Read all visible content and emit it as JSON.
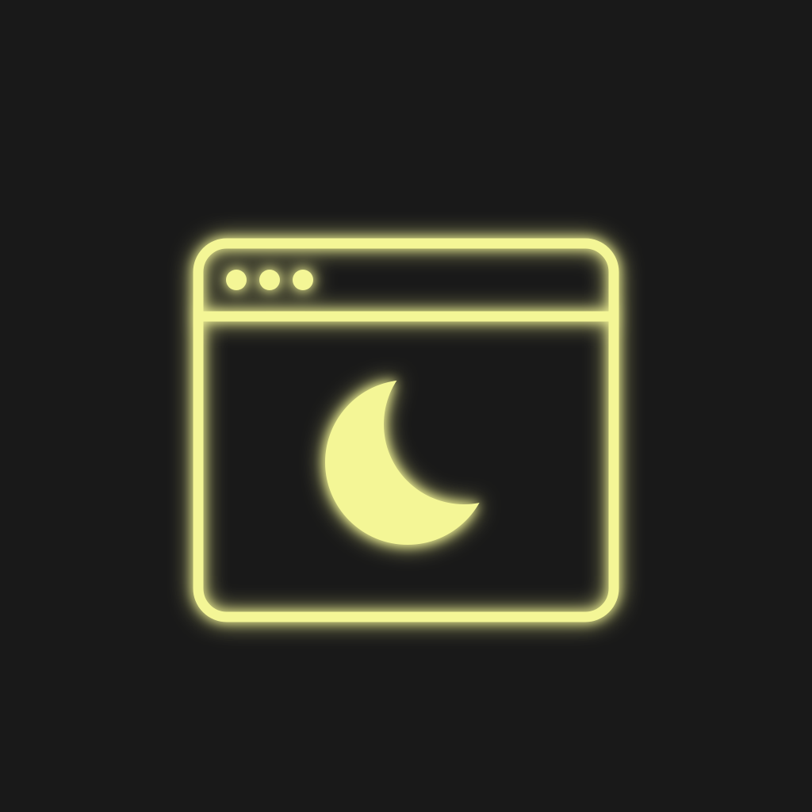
{
  "icon": {
    "name": "browser-window-dark-mode-icon",
    "parts": {
      "window_frame": "window-frame",
      "title_bar_divider": "title-bar-divider",
      "window_dots": [
        "window-dot",
        "window-dot",
        "window-dot"
      ],
      "content_icon": "crescent-moon-icon"
    }
  },
  "colors": {
    "background": "#191919",
    "accent": "#f4f696",
    "glow": "#e6f06a"
  }
}
